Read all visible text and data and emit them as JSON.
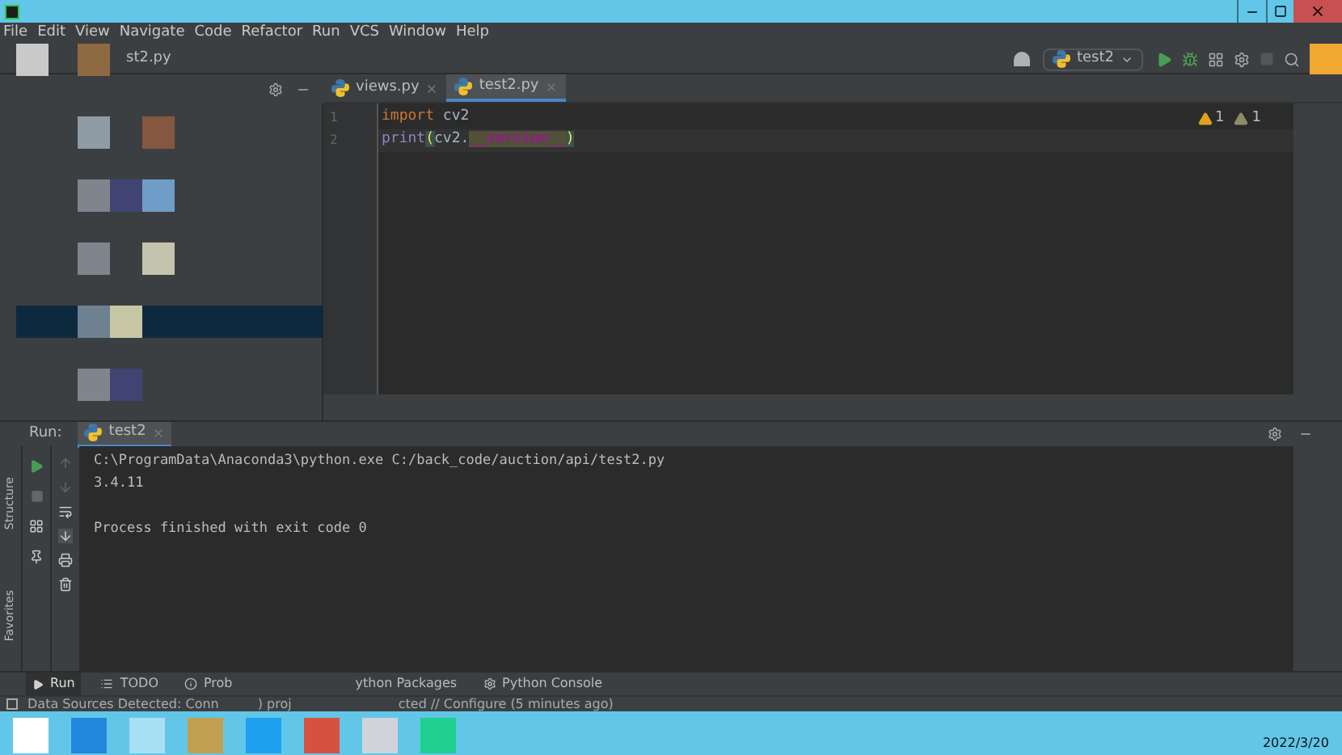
{
  "menu": [
    "File",
    "Edit",
    "View",
    "Navigate",
    "Code",
    "Refactor",
    "Run",
    "VCS",
    "Window",
    "Help"
  ],
  "breadcrumb": "st2.py",
  "run_config": "test2",
  "editor_tabs": [
    {
      "label": "views.py",
      "selected": false
    },
    {
      "label": "test2.py",
      "selected": true
    }
  ],
  "inspections": [
    {
      "kind": "warning",
      "count": "1"
    },
    {
      "kind": "weak",
      "count": "1"
    }
  ],
  "code": [
    {
      "number": "1",
      "tokens": [
        {
          "kind": "keyword",
          "text": "import"
        },
        {
          "kind": "plain",
          "text": " cv2"
        }
      ]
    },
    {
      "number": "2",
      "tokens": [
        {
          "kind": "builtin",
          "text": "print"
        },
        {
          "kind": "paren",
          "text": "("
        },
        {
          "kind": "plain",
          "text": "cv2."
        },
        {
          "kind": "dunder",
          "text": "__version__"
        },
        {
          "kind": "paren",
          "text": ")"
        }
      ]
    }
  ],
  "run_panel": {
    "label": "Run:",
    "tab": "test2",
    "output": [
      "C:\\ProgramData\\Anaconda3\\python.exe C:/back_code/auction/api/test2.py",
      "3.4.11"
    ],
    "exit_message": "Process finished with exit code 0"
  },
  "side_labels": [
    "Structure",
    "Favorites"
  ],
  "bottom_tabs": [
    {
      "label": "Run",
      "selected": true
    },
    {
      "label": "TODO",
      "selected": false
    },
    {
      "label": "Prob",
      "selected": false
    },
    {
      "label": "ython Packages",
      "selected": false
    },
    {
      "label": "Python Console",
      "selected": false
    }
  ],
  "status": [
    "Data Sources Detected: Conn",
    ") proj",
    "cted // Configure (5 minutes ago)"
  ],
  "taskbar": {
    "date": "2022/3/20"
  }
}
